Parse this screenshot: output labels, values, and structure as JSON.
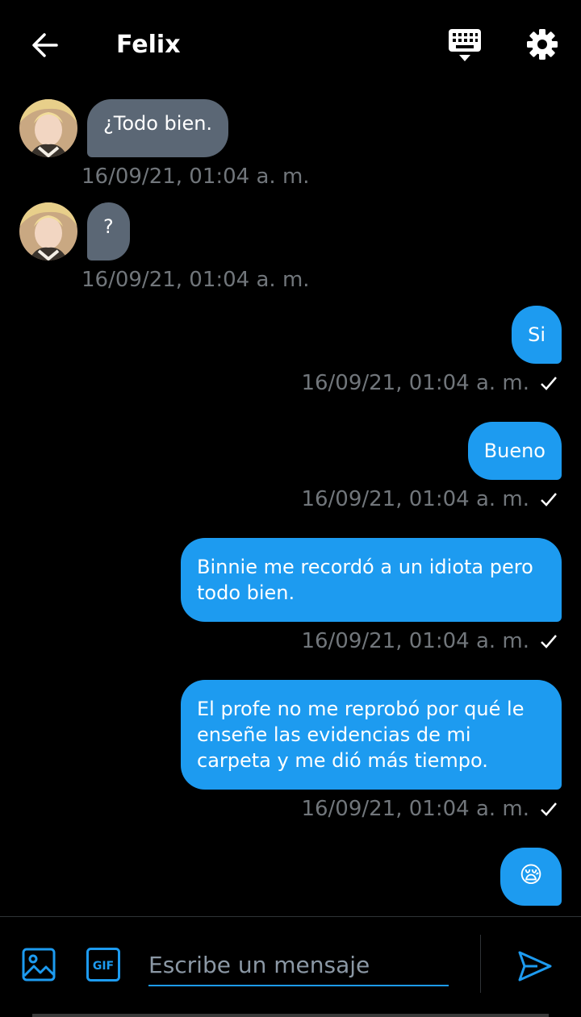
{
  "header": {
    "title": "Felix",
    "icons": [
      "back-arrow-icon",
      "keyboard-icon",
      "gear-icon"
    ]
  },
  "messages": [
    {
      "direction": "in",
      "text": "¿Todo bien.",
      "time": "16/09/21, 01:04 a. m."
    },
    {
      "direction": "in",
      "text": "?",
      "time": "16/09/21, 01:04 a. m."
    },
    {
      "direction": "out",
      "text": "Si",
      "time": "16/09/21, 01:04 a. m."
    },
    {
      "direction": "out",
      "text": "Bueno",
      "time": "16/09/21, 01:04 a. m."
    },
    {
      "direction": "out",
      "text": "Binnie me recordó a un idiota pero todo bien.",
      "time": "16/09/21, 01:04 a. m."
    },
    {
      "direction": "out",
      "text": "El profe no me reprobó por qué le enseñe las evidencias de mi carpeta y me dió más tiempo.",
      "time": "16/09/21, 01:04 a. m."
    },
    {
      "direction": "out",
      "text": "😪",
      "time": ""
    }
  ],
  "composer": {
    "placeholder": "Escribe un mensaje",
    "value": "",
    "gif_label": "GIF"
  },
  "colors": {
    "background": "#000000",
    "accent": "#1d9bf0",
    "incoming_bubble": "#5b6775",
    "timestamp": "#71767b"
  }
}
